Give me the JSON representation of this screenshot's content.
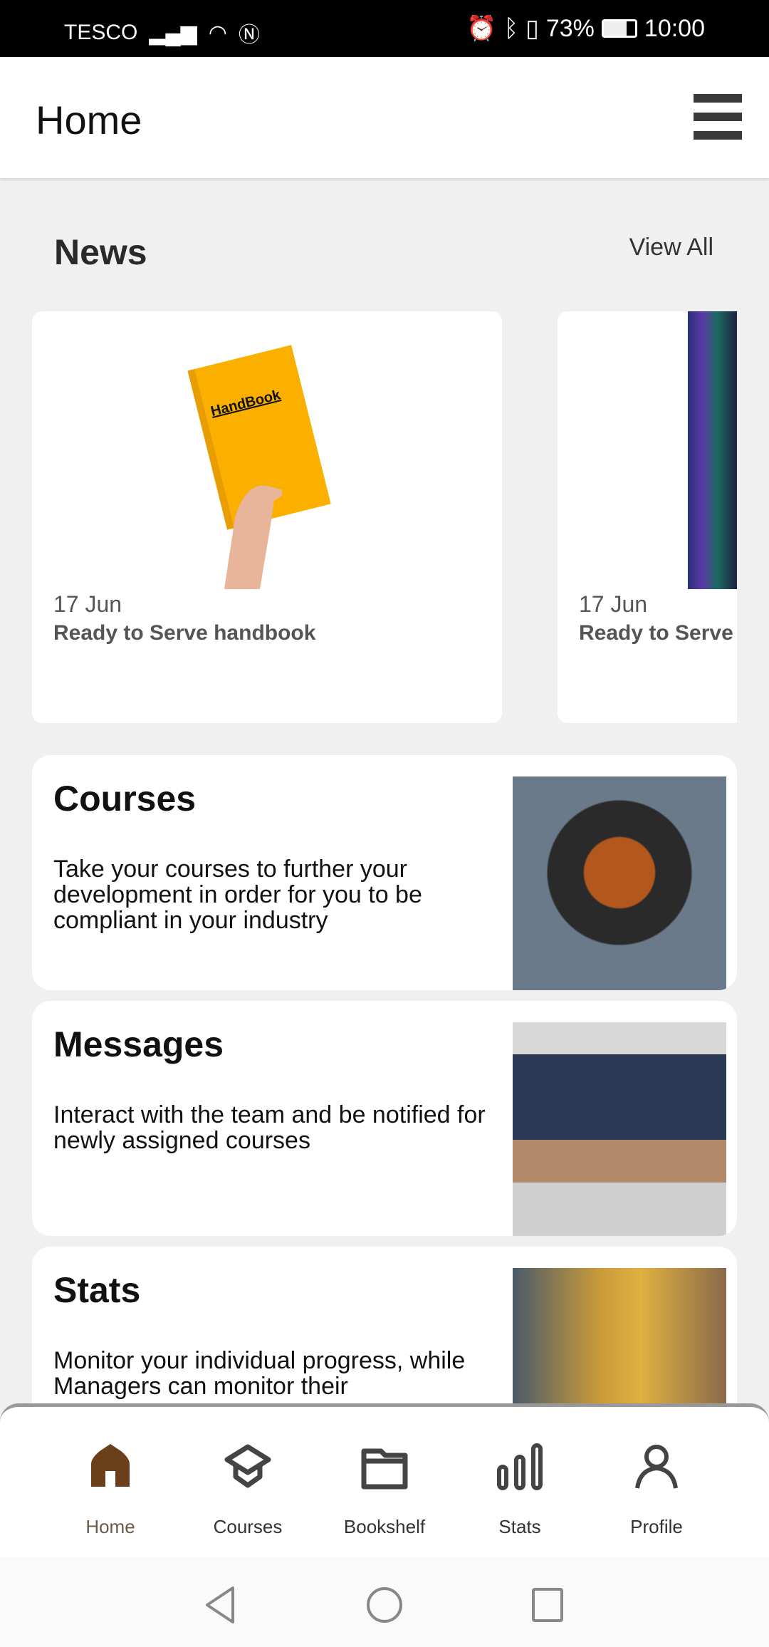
{
  "status_bar": {
    "carrier": "TESCO",
    "battery": "73%",
    "time": "10:00",
    "icons": [
      "signal-icon",
      "wifi-icon",
      "nfc-icon",
      "alarm-icon",
      "bluetooth-icon",
      "vibrate-icon",
      "battery-icon"
    ]
  },
  "header": {
    "title": "Home",
    "menu_icon": "hamburger-menu-icon"
  },
  "news": {
    "title": "News",
    "view_all": "View All",
    "items": [
      {
        "date": "17 Jun",
        "title": "Ready to Serve handbook",
        "image_text": "HandBook"
      },
      {
        "date": "17 Jun",
        "title": "Ready to Serve"
      }
    ]
  },
  "sections": [
    {
      "title": "Courses",
      "description": "Take your courses to further your development in order for you to be compliant in your industry"
    },
    {
      "title": "Messages",
      "description": "Interact with the team and be notified for newly assigned courses"
    },
    {
      "title": "Stats",
      "description": "Monitor your individual progress, while Managers can monitor their"
    }
  ],
  "bottom_nav": {
    "active": "Home",
    "active_color": "#6b3f1a",
    "items": [
      {
        "label": "Home",
        "icon": "home-icon"
      },
      {
        "label": "Courses",
        "icon": "graduation-cap-icon"
      },
      {
        "label": "Bookshelf",
        "icon": "folder-icon"
      },
      {
        "label": "Stats",
        "icon": "bar-chart-icon"
      },
      {
        "label": "Profile",
        "icon": "person-icon"
      }
    ]
  }
}
